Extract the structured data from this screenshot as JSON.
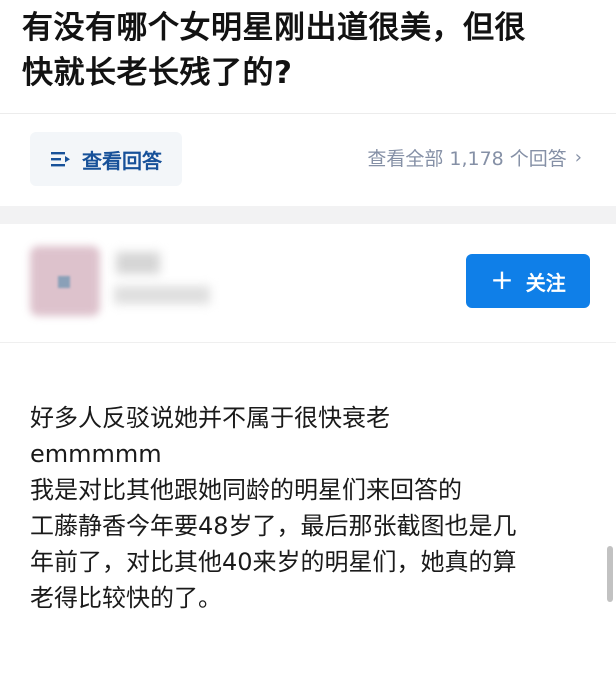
{
  "question": {
    "title_line1": "有没有哪个女明星刚出道很美，但很",
    "title_line2": "快就长老长残了的?"
  },
  "actions": {
    "view_answers_label": "查看回答",
    "all_answers_label": "查看全部 1,178 个回答"
  },
  "author": {
    "follow_label": "关注"
  },
  "answer": {
    "lines": [
      "好多人反驳说她并不属于很快衰老",
      "emmmmm",
      "我是对比其他跟她同龄的明星们来回答的",
      "工藤静香今年要48岁了，最后那张截图也是几",
      "年前了，对比其他40来岁的明星们，她真的算",
      "老得比较快的了。"
    ]
  },
  "colors": {
    "accent": "#0f7fe8",
    "link": "#175199",
    "muted": "#8590a6"
  }
}
